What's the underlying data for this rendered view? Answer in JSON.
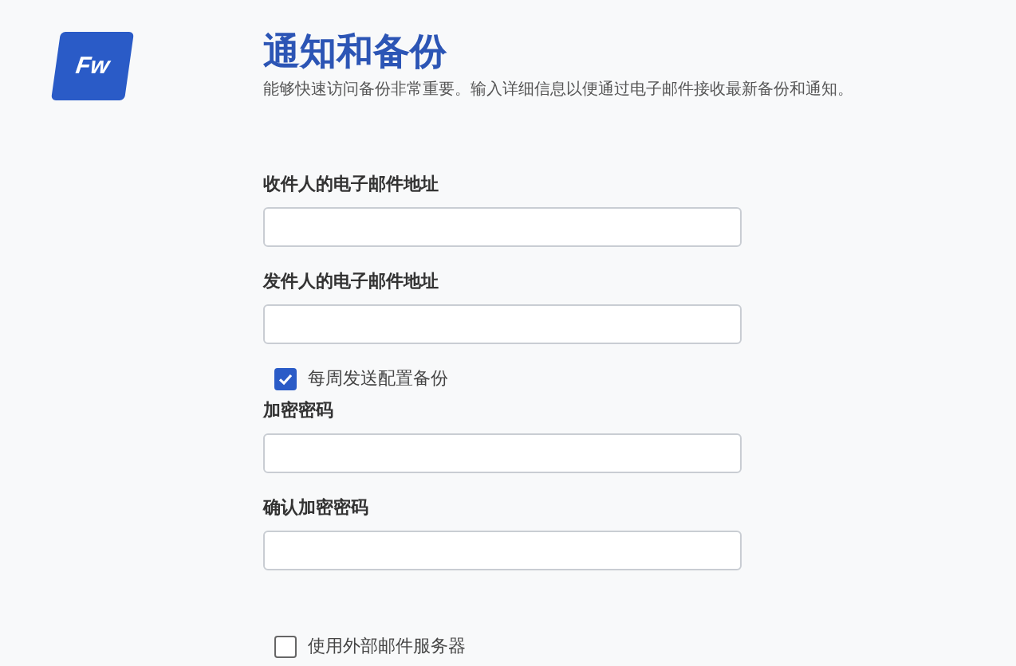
{
  "logo": {
    "text": "Fw"
  },
  "header": {
    "title": "通知和备份",
    "description": "能够快速访问备份非常重要。输入详细信息以便通过电子邮件接收最新备份和通知。"
  },
  "form": [
    {
      "kind": "field",
      "label": "收件人的电子邮件地址"
    },
    {
      "kind": "field",
      "label": "发件人的电子邮件地址"
    },
    {
      "kind": "checkbox",
      "label": "每周发送配置备份",
      "checked": true
    },
    {
      "kind": "field",
      "label": "加密密码"
    },
    {
      "kind": "field",
      "label": "确认加密密码"
    },
    {
      "kind": "spacer"
    },
    {
      "kind": "checkbox",
      "label": "使用外部邮件服务器",
      "checked": false
    }
  ]
}
